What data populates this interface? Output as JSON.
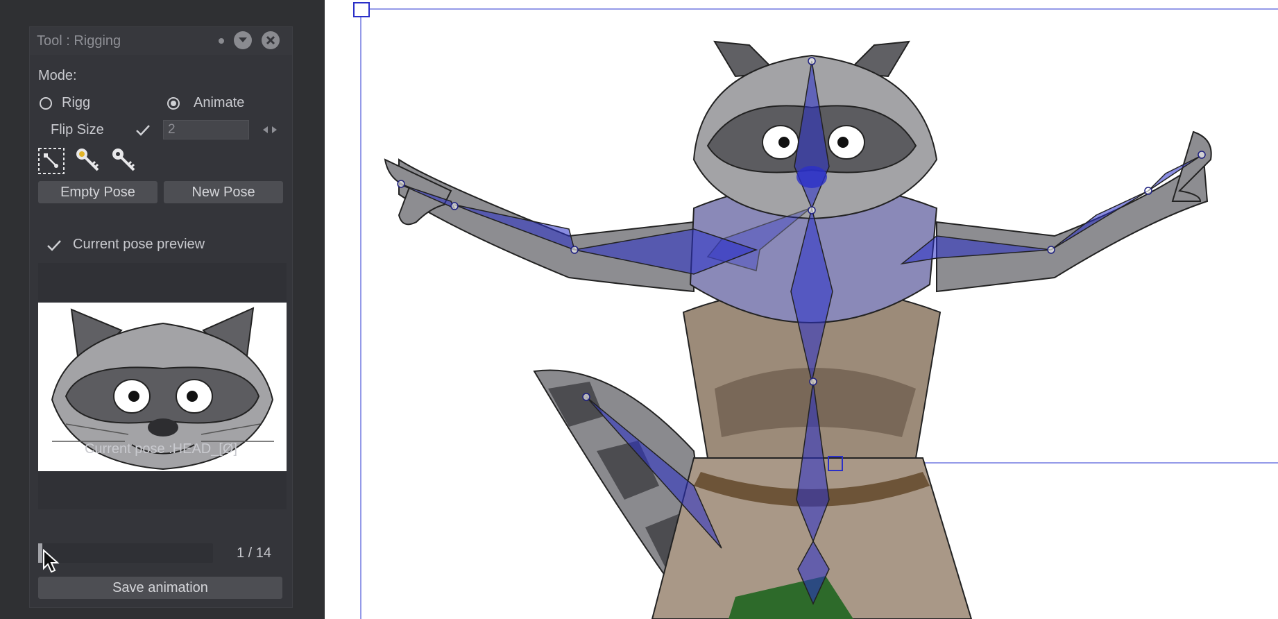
{
  "tool_panel": {
    "title": "Tool : Rigging",
    "mode_label": "Mode:",
    "modes": [
      {
        "label": "Rigg",
        "selected": false
      },
      {
        "label": "Animate",
        "selected": true
      }
    ],
    "flip_size_label": "Flip Size",
    "flip_size_value": "2",
    "buttons": {
      "empty_pose": "Empty Pose",
      "new_pose": "New Pose",
      "save_animation": "Save animation"
    },
    "current_pose_preview_label": "Current pose preview",
    "current_pose_label": "Current pose :HEAD_[Ø]",
    "frame_counter": "1 / 14",
    "frame_progress": 0.07,
    "icons": [
      "selection-tool-icon",
      "key-gold-icon",
      "key-gray-icon",
      "chevron-down-icon",
      "close-icon",
      "checkmark-icon",
      "spinner-arrows-icon"
    ]
  },
  "colors": {
    "panel_bg": "#34353a",
    "sidebar_bg": "#2f3033",
    "bone_blue": "#2a2fc8",
    "selection_line": "#7078e0"
  }
}
